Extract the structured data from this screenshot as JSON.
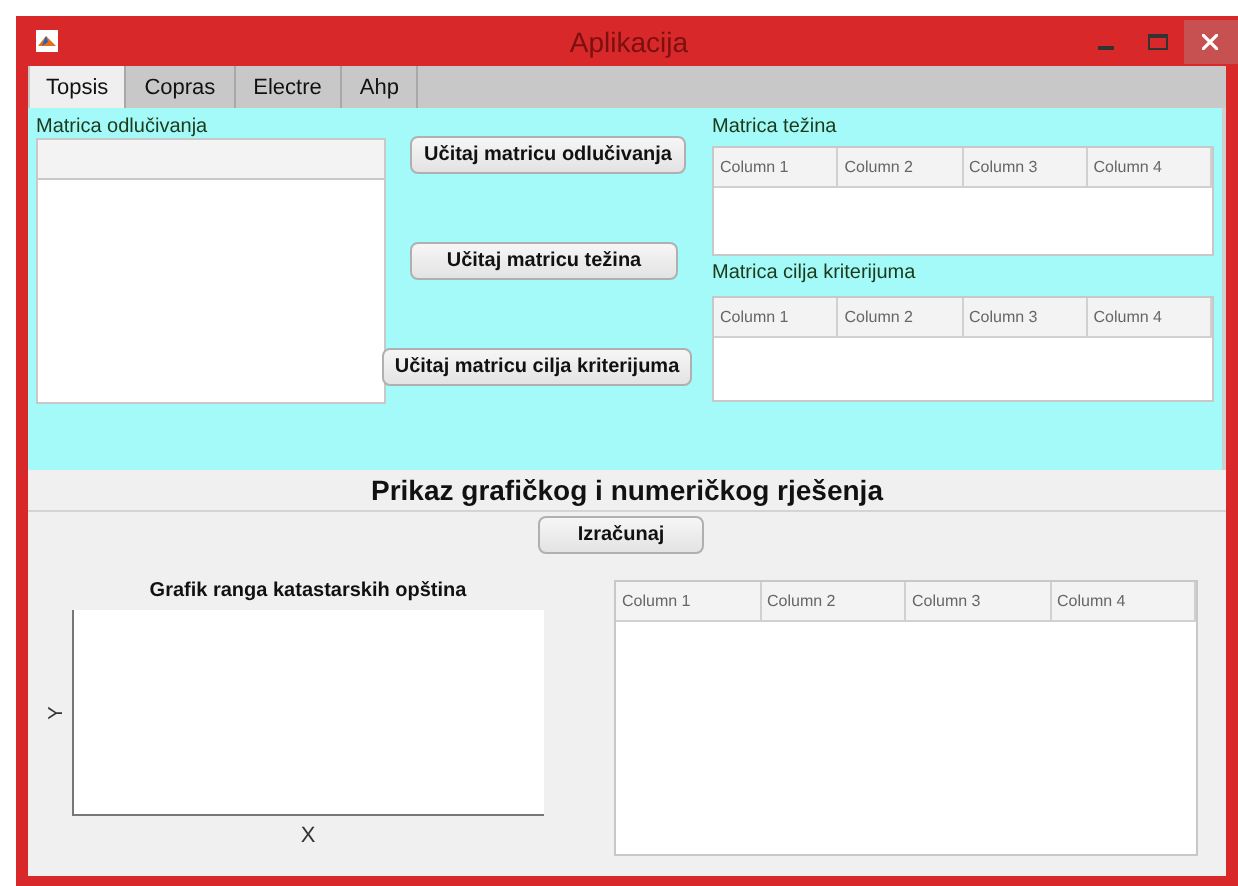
{
  "window": {
    "title": "Aplikacija"
  },
  "tabs": [
    {
      "label": "Topsis",
      "selected": true
    },
    {
      "label": "Copras",
      "selected": false
    },
    {
      "label": "Electre",
      "selected": false
    },
    {
      "label": "Ahp",
      "selected": false
    }
  ],
  "decision_matrix": {
    "label": "Matrica odlučivanja"
  },
  "load_buttons": [
    "Učitaj matricu odlučivanja",
    "Učitaj matricu težina",
    "Učitaj matricu cilja kriterijuma"
  ],
  "weights_table": {
    "label": "Matrica težina",
    "columns": [
      "Column 1",
      "Column 2",
      "Column 3",
      "Column 4"
    ]
  },
  "target_table": {
    "label": "Matrica cilja kriterijuma",
    "columns": [
      "Column 1",
      "Column 2",
      "Column 3",
      "Column 4"
    ]
  },
  "results": {
    "heading": "Prikaz grafičkog i numeričkog rješenja",
    "button": "Izračunaj",
    "plot": {
      "title": "Grafik ranga katastarskih opština",
      "xlabel": "X",
      "ylabel": "Y"
    },
    "table": {
      "columns": [
        "Column 1",
        "Column 2",
        "Column 3",
        "Column 4"
      ]
    }
  }
}
